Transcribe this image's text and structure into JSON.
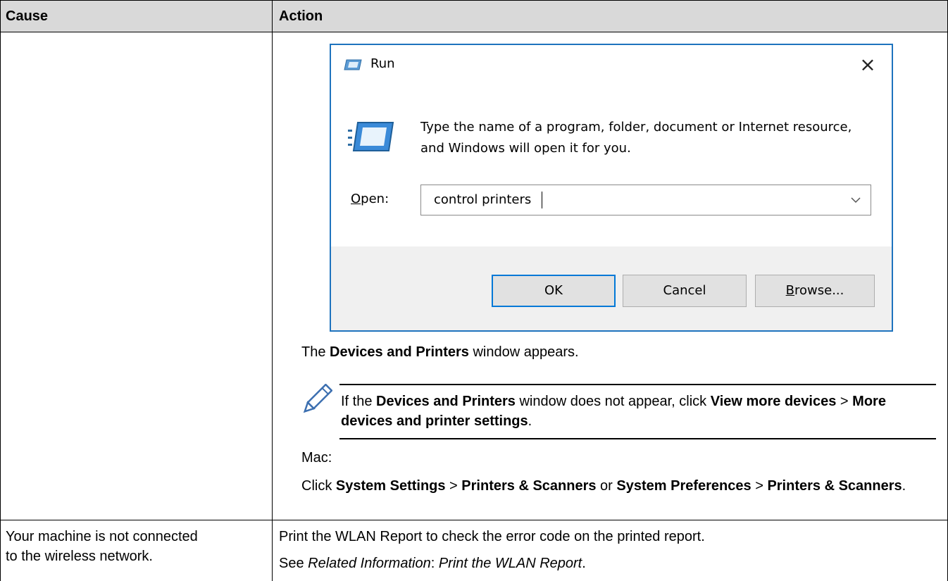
{
  "table": {
    "headers": {
      "cause": "Cause",
      "action": "Action"
    }
  },
  "run_dialog": {
    "title": "Run",
    "close_glyph": "×",
    "description": "Type the name of a program, folder, document or Internet resource, and Windows will open it for you.",
    "open_label_accesskey": "O",
    "open_label_rest": "pen:",
    "input_value": "control printers",
    "buttons": {
      "ok": "OK",
      "cancel": "Cancel",
      "browse_accesskey": "B",
      "browse_rest": "rowse..."
    }
  },
  "row1_action": {
    "appears_prefix": "The ",
    "appears_bold": "Devices and Printers",
    "appears_suffix": " window appears.",
    "note": {
      "icon": "pencil-icon",
      "p1": "If the ",
      "b1": "Devices and Printers",
      "p2": " window does not appear, click ",
      "b2": "View more devices",
      "p3": " > ",
      "b3": "More devices and printer settings",
      "p4": "."
    },
    "mac_label": "Mac:",
    "mac": {
      "p1": "Click ",
      "b1": "System Settings",
      "p2": " > ",
      "b2": "Printers & Scanners",
      "p3": " or ",
      "b3": "System Preferences",
      "p4": " > ",
      "b4": "Printers & Scanners",
      "p5": "."
    }
  },
  "row2": {
    "cause_line1": "Your machine is not connected",
    "cause_line2": "to the wireless network.",
    "action_line1": "Print the WLAN Report to check the error code on the printed report.",
    "see_italic1": "Related Information",
    "see_prefix": "See ",
    "see_colon": ": ",
    "see_italic2": "Print the WLAN Report",
    "see_end": "."
  },
  "colors": {
    "header_bg": "#d9d9d9",
    "dialog_border": "#1e73be",
    "dialog_footer": "#f0f0f0",
    "default_button_border": "#0078d7"
  }
}
